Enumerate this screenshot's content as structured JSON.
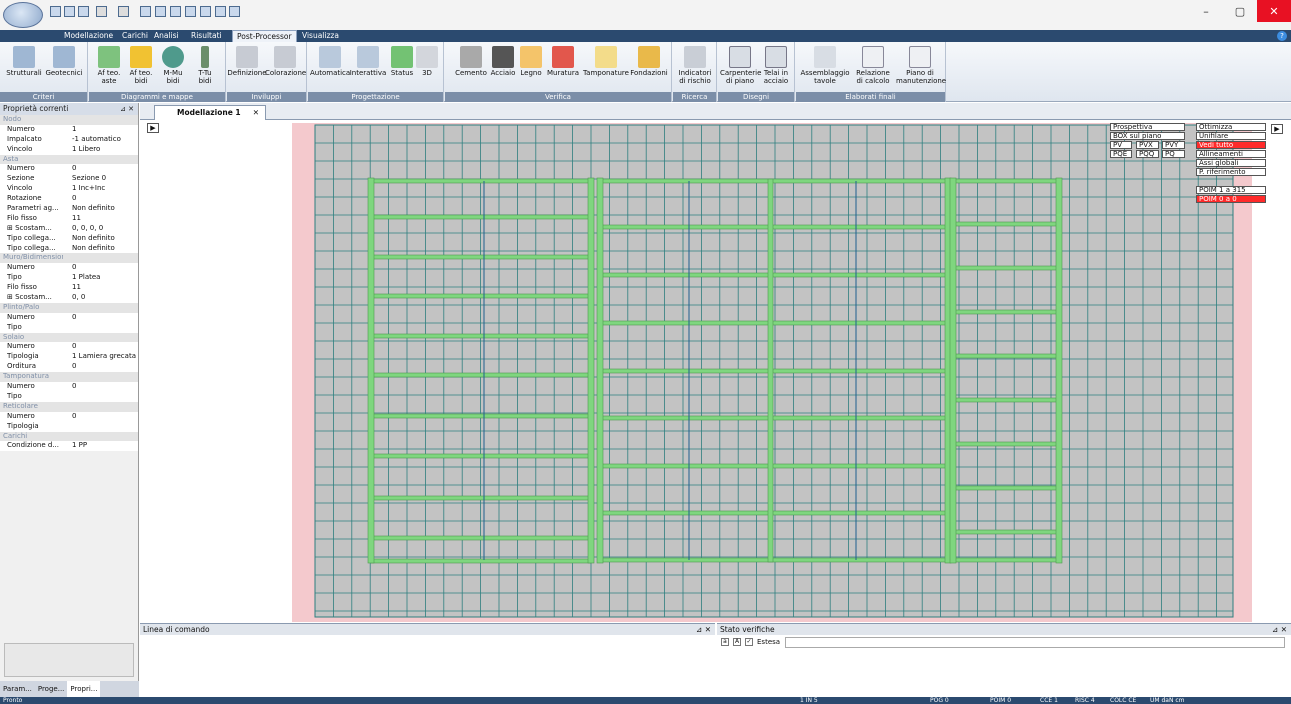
{
  "ribbon_tabs": [
    "Modellazione",
    "Carichi",
    "Analisi",
    "Risultati",
    "Post-Processor",
    "Visualizza"
  ],
  "active_tab": "Post-Processor",
  "groups": [
    {
      "title": "Criteri",
      "buttons": [
        "Strutturali",
        "Geotecnici"
      ]
    },
    {
      "title": "Diagrammi e mappe",
      "buttons": [
        "Af teo.\naste",
        "Af teo.\nbidi",
        "M-Mu\nbidi",
        "T-Tu\nbidi"
      ]
    },
    {
      "title": "Inviluppi",
      "buttons": [
        "Definizione",
        "Colorazione"
      ]
    },
    {
      "title": "Progettazione",
      "buttons": [
        "Automatica",
        "Interattiva",
        "Status",
        "3D"
      ]
    },
    {
      "title": "Verifica",
      "buttons": [
        "Cemento",
        "Acciaio",
        "Legno",
        "Muratura",
        "Tamponature",
        "Fondazioni"
      ]
    },
    {
      "title": "Ricerca",
      "buttons": [
        "Indicatori\ndi rischio"
      ]
    },
    {
      "title": "Disegni",
      "buttons": [
        "Carpenterie\ndi piano",
        "Telai in\nacciaio"
      ]
    },
    {
      "title": "Elaborati finali",
      "buttons": [
        "Assemblaggio\ntavole",
        "Relazione\ndi calcolo",
        "Piano di\nmanutenzione"
      ]
    }
  ],
  "left_panel": {
    "title": "Proprietà correnti",
    "rows": [
      {
        "cat": "Nodo"
      },
      {
        "k": "Numero",
        "v": "1"
      },
      {
        "k": "Impalcato",
        "v": "-1 automatico"
      },
      {
        "k": "Vincolo",
        "v": "1 Libero"
      },
      {
        "cat": "Asta"
      },
      {
        "k": "Numero",
        "v": "0"
      },
      {
        "k": "Sezione",
        "v": "Sezione 0"
      },
      {
        "k": "Vincolo",
        "v": "1 Inc+Inc"
      },
      {
        "k": "Rotazione",
        "v": "0"
      },
      {
        "k": "Parametri ag...",
        "v": "Non definito"
      },
      {
        "k": "Filo fisso",
        "v": "11"
      },
      {
        "k": "⊞ Scostam...",
        "v": "0, 0, 0, 0"
      },
      {
        "k": "Tipo collega...",
        "v": "Non definito"
      },
      {
        "k": "Tipo collega...",
        "v": "Non definito"
      },
      {
        "cat": "Muro/Bidimensionale"
      },
      {
        "k": "Numero",
        "v": "0"
      },
      {
        "k": "Tipo",
        "v": "1 Platea"
      },
      {
        "k": "Filo fisso",
        "v": "11"
      },
      {
        "k": "⊞ Scostam...",
        "v": "0, 0"
      },
      {
        "cat": "Plinto/Palo"
      },
      {
        "k": "Numero",
        "v": "0"
      },
      {
        "k": "Tipo",
        "v": ""
      },
      {
        "cat": "Solaio"
      },
      {
        "k": "Numero",
        "v": "0"
      },
      {
        "k": "Tipologia",
        "v": "1 Lamiera grecata"
      },
      {
        "k": "Orditura",
        "v": "0"
      },
      {
        "cat": "Tamponatura"
      },
      {
        "k": "Numero",
        "v": "0"
      },
      {
        "k": "Tipo",
        "v": ""
      },
      {
        "cat": "Reticolare"
      },
      {
        "k": "Numero",
        "v": "0"
      },
      {
        "k": "Tipologia",
        "v": ""
      },
      {
        "cat": "Carichi"
      },
      {
        "k": "Condizione d...",
        "v": "1 PP"
      }
    ],
    "tabs": [
      "Param...",
      "Proge...",
      "Propri..."
    ]
  },
  "document_tab": "Modellazione 1",
  "viewport_controls": {
    "left": [
      "Prospettiva",
      "BOX sul piano",
      "PV",
      "PVX",
      "PVY",
      "PQE",
      "PQQ",
      "PQ"
    ],
    "right": [
      "Ottimizza",
      "Unifilare",
      "Vedi tutto",
      "Allineamenti",
      "Assi globali",
      "P. riferimento",
      "POIM   1 a  315",
      "POIM   0 a     0"
    ]
  },
  "command_panel_title": "Linea di comando",
  "status_panel": {
    "title": "Stato verifiche",
    "checkbox_label": "Estesa"
  },
  "statusbar": {
    "left": "Pronto",
    "items": [
      "1  IN  5",
      "POG 0",
      "POIM 0",
      "CCE 1",
      "RISC 4",
      "COLC CE",
      "UM daN cm"
    ]
  },
  "colors": {
    "beam": "#7fd67f",
    "grid": "#2e7f7f",
    "slab": "#c3c3c3",
    "pink": "#f4c9cd",
    "accent": "#2b4a6f"
  }
}
